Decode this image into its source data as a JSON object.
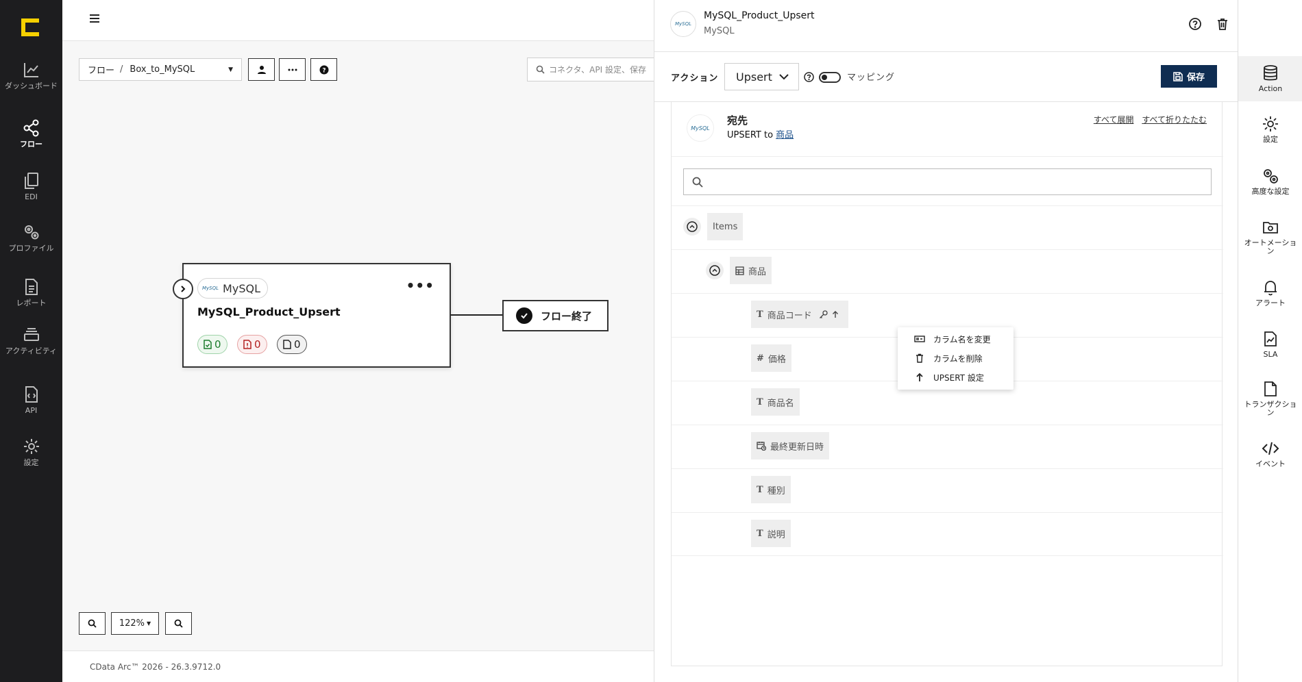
{
  "leftnav": {
    "items": [
      {
        "label": "ダッシュボード",
        "icon": "chart-line-icon"
      },
      {
        "label": "フロー",
        "icon": "share-nodes-icon",
        "active": true
      },
      {
        "label": "EDI",
        "icon": "copy-icon"
      },
      {
        "label": "プロファイル",
        "icon": "gears-icon"
      },
      {
        "label": "レポート",
        "icon": "file-lines-icon"
      },
      {
        "label": "アクティビティ",
        "icon": "layers-icon"
      },
      {
        "label": "API",
        "icon": "file-code-icon"
      },
      {
        "label": "設定",
        "icon": "gear-icon"
      }
    ]
  },
  "canvas": {
    "breadcrumb_root": "フロー",
    "breadcrumb_sep": "/",
    "breadcrumb_current": "Box_to_MySQL",
    "search_placeholder": "コネクタ、API 設定、保存",
    "node": {
      "connector": "MySQL",
      "connector_mini": "MySQL",
      "title": "MySQL_Product_Upsert",
      "success_count": "0",
      "error_count": "0",
      "pending_count": "0"
    },
    "end_node": "フロー終了",
    "zoom": "122%",
    "footer": "CData Arc™ 2026 - 26.3.9712.0"
  },
  "panel": {
    "title": "MySQL_Product_Upsert",
    "subtitle": "MySQL",
    "logo_text": "MySQL",
    "action_label": "アクション",
    "action_value": "Upsert",
    "mapping_label": "マッピング",
    "save_label": "保存",
    "dest_title": "宛先",
    "dest_desc": "UPSERT to",
    "dest_table": "商品",
    "expand_all": "すべて展開",
    "collapse_all": "すべて折りたたむ",
    "tree": {
      "root": "Items",
      "table": "商品",
      "columns": [
        {
          "name": "商品コード",
          "type": "T"
        },
        {
          "name": "価格",
          "type": "#"
        },
        {
          "name": "商品名",
          "type": "T"
        },
        {
          "name": "最終更新日時",
          "type": "datetime"
        },
        {
          "name": "種別",
          "type": "T"
        },
        {
          "name": "説明",
          "type": "T"
        }
      ]
    },
    "context_menu": [
      "カラム名を変更",
      "カラムを削除",
      "UPSERT 設定"
    ]
  },
  "rightnav": {
    "items": [
      {
        "label": "Action",
        "icon": "database-icon",
        "active": true
      },
      {
        "label": "設定",
        "icon": "gear-icon"
      },
      {
        "label": "高度な設定",
        "icon": "gears-icon"
      },
      {
        "label": "オートメーション",
        "icon": "folder-gear-icon"
      },
      {
        "label": "アラート",
        "icon": "bell-icon"
      },
      {
        "label": "SLA",
        "icon": "file-chart-icon"
      },
      {
        "label": "トランザクション",
        "icon": "file-icon"
      },
      {
        "label": "イベント",
        "icon": "code-icon"
      }
    ]
  }
}
